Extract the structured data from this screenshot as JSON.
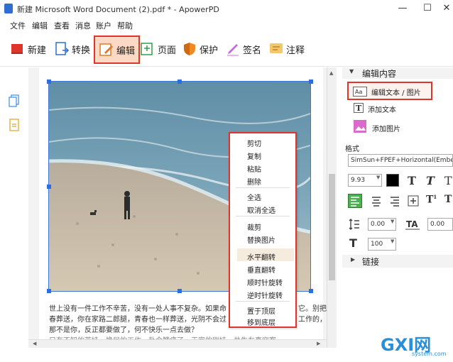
{
  "window": {
    "title": "新建 Microsoft Word Document (2).pdf * - ApowerPD",
    "minimize": "—",
    "maximize": "☐",
    "close": "✕"
  },
  "menu": [
    "文件",
    "编辑",
    "查看",
    "消息",
    "账户",
    "帮助"
  ],
  "toolbar": [
    {
      "label": "新建",
      "icon": "new-file-icon"
    },
    {
      "label": "转换",
      "icon": "convert-icon"
    },
    {
      "label": "编辑",
      "icon": "edit-icon",
      "active": true
    },
    {
      "label": "页面",
      "icon": "page-icon"
    },
    {
      "label": "保护",
      "icon": "shield-icon"
    },
    {
      "label": "签名",
      "icon": "pen-icon"
    },
    {
      "label": "注释",
      "icon": "comment-icon"
    }
  ],
  "document": {
    "text_lines": [
      "世上没有一件工作不辛苦，没有一处人事不复杂。如果命",
      "春葬送，你在家路二郎腿，青春也一样葬送，光阴不会过",
      "那不是你，反正都要做了，何不快乐一点去做？",
      "只有不知的苦娃，换届的工作，赴今赞痛了，王字的刚娃，共生左真空客"
    ],
    "text_lines_right": [
      "它。别把",
      "工作的，"
    ]
  },
  "context_menu": {
    "items": [
      "剪切",
      "复制",
      "粘贴",
      "删除",
      "全选",
      "取消全选",
      "裁剪",
      "替换图片",
      "水平翻转",
      "垂直翻转",
      "顺时针旋转",
      "逆时针旋转",
      "置于顶层",
      "移到底层"
    ],
    "highlighted": "水平翻转"
  },
  "right_panel": {
    "section_title": "编辑内容",
    "edit_text_image": "编辑文本 / 图片",
    "add_text": "添加文本",
    "add_image": "添加图片",
    "format_label": "格式",
    "font_name": "SimSun+FPEF+Horizontal(Embedded)",
    "font_size": "9.93",
    "line_spacing": "0.00",
    "char_spacing": "0.00",
    "scale": "100",
    "links_label": "链接"
  },
  "watermark": {
    "brand": "GXI网",
    "sub": "system.com"
  },
  "colors": {
    "accent_red": "#e0352b",
    "active_bg": "#fbd9c4",
    "selection_blue": "#2a6ee0"
  }
}
